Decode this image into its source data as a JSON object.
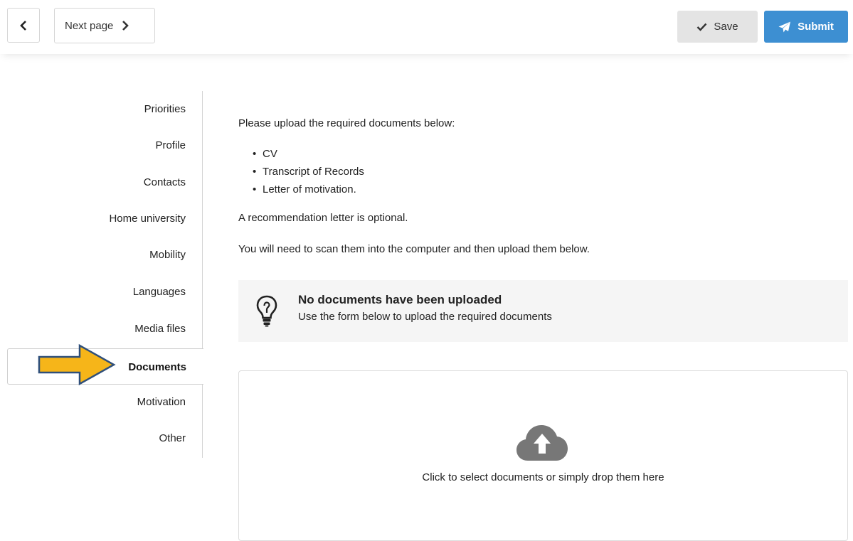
{
  "toolbar": {
    "next_label": "Next page",
    "save_label": "Save",
    "submit_label": "Submit",
    "submit_color": "#3d8fd2"
  },
  "sidebar": {
    "items": [
      {
        "label": "Priorities"
      },
      {
        "label": "Profile"
      },
      {
        "label": "Contacts"
      },
      {
        "label": "Home university"
      },
      {
        "label": "Mobility"
      },
      {
        "label": "Languages"
      },
      {
        "label": "Media files"
      },
      {
        "label": "Documents",
        "active": true
      },
      {
        "label": "Motivation"
      },
      {
        "label": "Other"
      }
    ],
    "highlight_arrow_color": "#f6b519"
  },
  "main": {
    "intro": "Please upload the required documents below:",
    "required_documents": [
      "CV",
      "Transcript of Records",
      "Letter of motivation."
    ],
    "optional_note": "A recommendation letter is optional.",
    "scan_note": "You will need to scan them into the computer and then upload them below."
  },
  "notice": {
    "icon": "lightbulb-icon",
    "title": "No documents have been uploaded",
    "subtitle": "Use the form below to upload the required documents"
  },
  "dropzone": {
    "icon": "cloud-upload-icon",
    "text": "Click to select documents or simply drop them here"
  }
}
